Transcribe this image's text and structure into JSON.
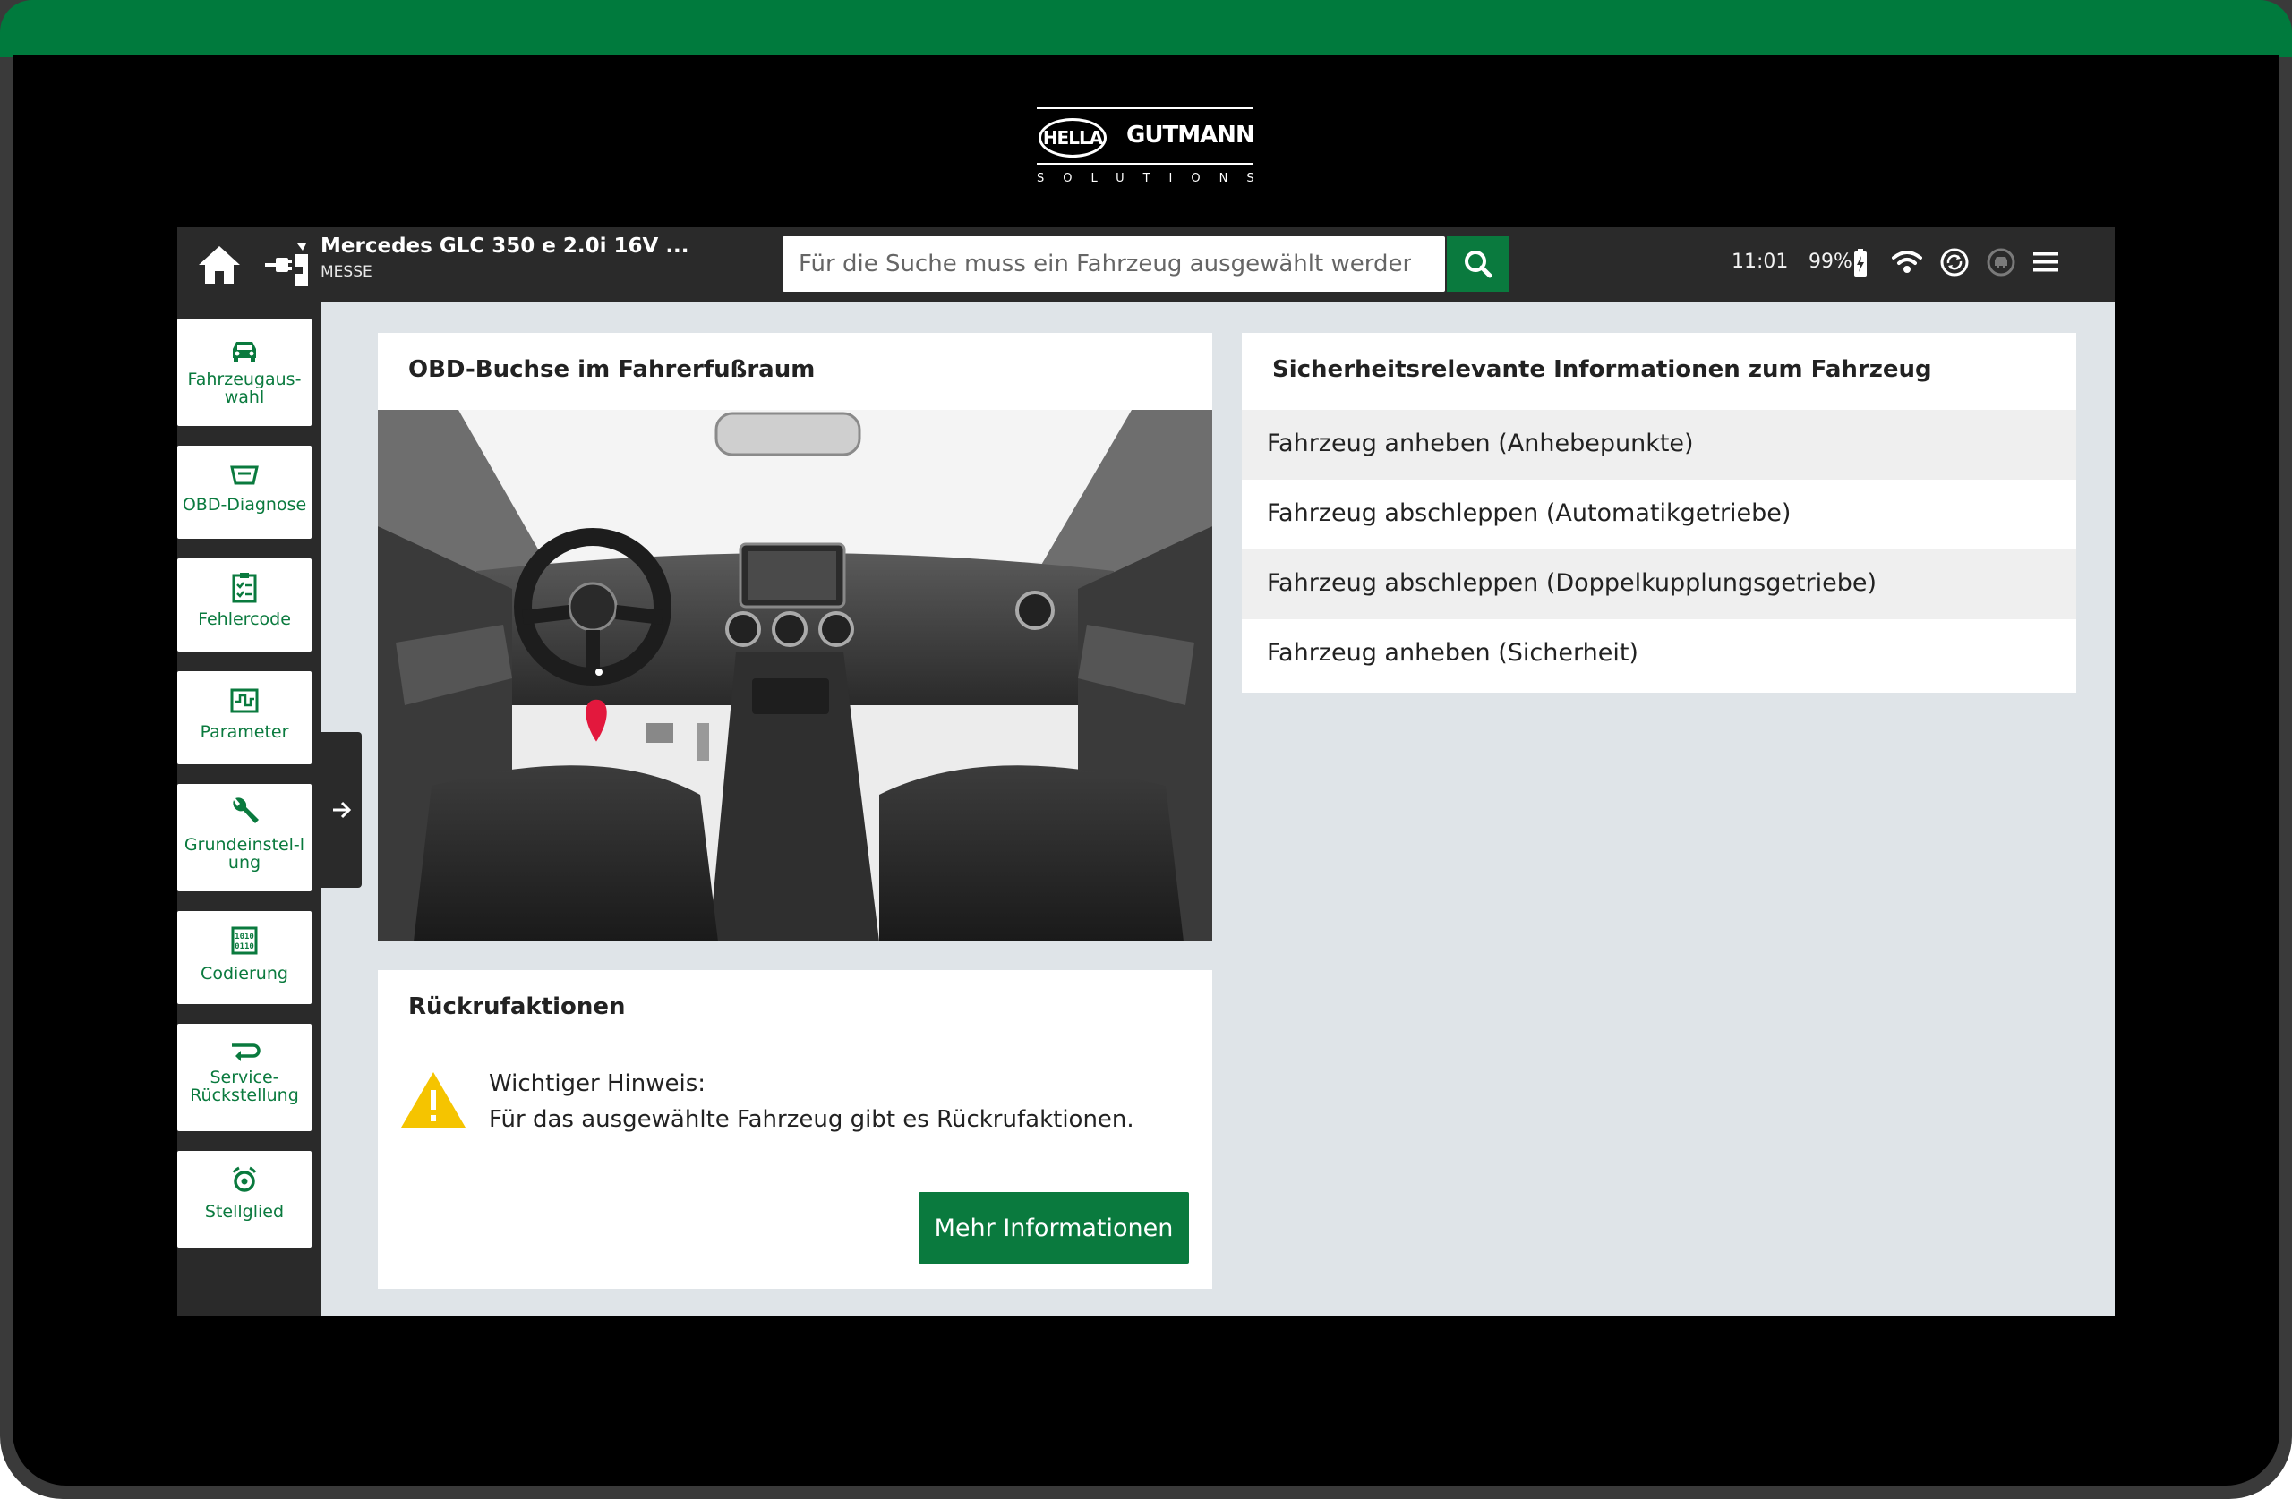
{
  "brand": {
    "hella": "HELLA",
    "gutmann": "GUTMANN",
    "solutions": "SOLUTIONS"
  },
  "topbar": {
    "vehicle_title": "Mercedes GLC 350 e 2.0i 16V ...",
    "vehicle_sub": "MESSE",
    "search_placeholder": "Für die Suche muss ein Fahrzeug ausgewählt werden.",
    "time": "11:01",
    "battery": "99%",
    "icons": [
      "home-icon",
      "obd-plug-icon",
      "search-icon",
      "battery-icon",
      "wifi-icon",
      "sync-icon",
      "car-status-icon",
      "menu-icon"
    ]
  },
  "sidebar": {
    "items": [
      {
        "label": "Fahrzeugaus-wahl",
        "icon": "car-icon"
      },
      {
        "label": "OBD-Diagnose",
        "icon": "obd-icon"
      },
      {
        "label": "Fehlercode",
        "icon": "checklist-icon"
      },
      {
        "label": "Parameter",
        "icon": "parameter-icon"
      },
      {
        "label": "Grundeinstel-lung",
        "icon": "wrench-icon"
      },
      {
        "label": "Codierung",
        "icon": "binary-icon"
      },
      {
        "label": "Service-Rückstellung",
        "icon": "service-reset-icon"
      },
      {
        "label": "Stellglied",
        "icon": "actuator-icon"
      }
    ]
  },
  "obd_card": {
    "title": "OBD-Buchse im Fahrerfußraum"
  },
  "recall_card": {
    "title": "Rückrufaktionen",
    "notice_title": "Wichtiger Hinweis:",
    "notice_text": "Für das ausgewählte Fahrzeug gibt es Rückrufaktionen.",
    "button": "Mehr Informationen"
  },
  "safety_card": {
    "title": "Sicherheitsrelevante Informationen zum Fahrzeug",
    "items": [
      "Fahrzeug anheben (Anhebepunkte)",
      "Fahrzeug abschleppen (Automatikgetriebe)",
      "Fahrzeug abschleppen (Doppelkupplungsgetriebe)",
      "Fahrzeug anheben (Sicherheit)"
    ]
  },
  "colors": {
    "brand_green": "#0a7a3e",
    "bar_dark": "#2a2a2a",
    "content_bg": "#dfe4e8",
    "warning": "#f5c400",
    "marker": "#e3183d"
  }
}
